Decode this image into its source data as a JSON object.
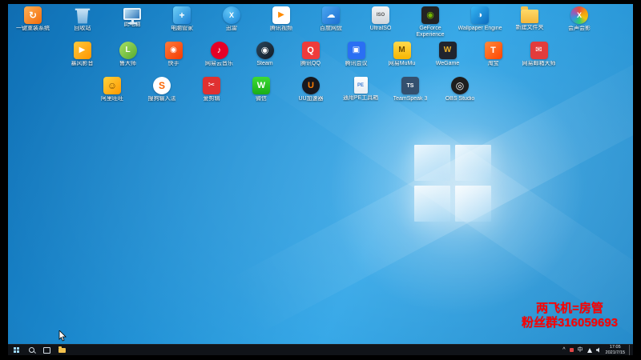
{
  "colors": {
    "wallpaper_base": "#1e8fd4",
    "taskbar": "#101318",
    "overlay_text": "#ff0000",
    "icon_label_text": "#ffffff"
  },
  "overlay": {
    "line1": "两飞机=房管",
    "line2": "粉丝群316059693"
  },
  "taskbar": {
    "tray": {
      "hidden_icons": "^",
      "ime": "中",
      "time": "17:05",
      "date": "2021/7/15"
    }
  },
  "desktop": {
    "rows": [
      {
        "items": [
          {
            "name": "yijian-chongzhuang",
            "label": "一键重装系统",
            "bg": "linear-gradient(135deg,#ffb054,#f26c0d)",
            "glyph": "↻",
            "gs": 12
          },
          {
            "name": "recycle-bin",
            "label": "回收站",
            "shape": "bin"
          },
          {
            "name": "this-pc",
            "label": "此电脑",
            "shape": "monitor"
          },
          {
            "name": "diannao-guanjia",
            "label": "电脑管家",
            "bg": "linear-gradient(135deg,#6fd0f7,#1a7fd4)",
            "glyph": "+",
            "gs": 12
          },
          {
            "name": "xunlei",
            "label": "迅雷",
            "shape": "circle",
            "bg": "radial-gradient(circle at 35% 30%,#5fc3f5,#1582d6)",
            "glyph": "X",
            "gs": 9
          },
          {
            "name": "tengxun-shipin",
            "label": "腾讯视频",
            "bg": "#ffffff",
            "glyph": "▶",
            "fg": "#ff8a00",
            "gs": 10
          },
          {
            "name": "baidu-wangpan",
            "label": "百度网盘",
            "bg": "linear-gradient(135deg,#4aa7f0,#1d6fd2)",
            "glyph": "☁",
            "gs": 11
          },
          {
            "name": "ultraiso",
            "label": "UltraISO",
            "bg": "linear-gradient(#f2f4f6,#cfd6dc)",
            "glyph": "ISO",
            "fg": "#555555",
            "gs": 6
          },
          {
            "name": "geforce-experience",
            "label": "GeForce Experience",
            "bg": "#232323",
            "glyph": "◉",
            "fg": "#76b900",
            "gs": 11
          },
          {
            "name": "wallpaper-engine",
            "label": "Wallpaper Engine",
            "bg": "linear-gradient(135deg,#35b5f2,#0c6cc0)",
            "glyph": "◑",
            "gs": 11
          },
          {
            "name": "new-folder",
            "label": "新建文件夹",
            "shape": "folder"
          },
          {
            "name": "huishenghuiying",
            "label": "会声会影",
            "shape": "circle",
            "bg": "conic-gradient(#e74c3c,#f39c12,#f1c40f,#2ecc71,#3498db,#9b59b6,#e74c3c)",
            "glyph": "X",
            "gs": 9
          }
        ]
      },
      {
        "items": [
          {
            "name": "baofeng-yingyin",
            "label": "暴风影音",
            "bg": "linear-gradient(135deg,#ffc93c,#ff9500)",
            "glyph": "▶",
            "gs": 10
          },
          {
            "name": "ludashi",
            "label": "鲁大师",
            "shape": "circle",
            "bg": "linear-gradient(135deg,#a8e063,#56ab2f)",
            "glyph": "L",
            "gs": 10
          },
          {
            "name": "kuaishou",
            "label": "快手",
            "bg": "linear-gradient(135deg,#ff7a3c,#f43b00)",
            "glyph": "◉",
            "gs": 10
          },
          {
            "name": "netease-music",
            "label": "网易云音乐",
            "shape": "circle",
            "bg": "#e60026",
            "glyph": "♪",
            "gs": 11
          },
          {
            "name": "steam",
            "label": "Steam",
            "shape": "circle",
            "bg": "linear-gradient(135deg,#2a475e,#121a24)",
            "glyph": "◉",
            "gs": 11
          },
          {
            "name": "tengxun-qq",
            "label": "腾讯QQ",
            "bg": "#ef3b3b",
            "glyph": "Q",
            "gs": 11
          },
          {
            "name": "tencent-meeting",
            "label": "腾讯会议",
            "bg": "#2a6ff3",
            "glyph": "▣",
            "gs": 10
          },
          {
            "name": "netease-mumu",
            "label": "网易MuMu",
            "bg": "linear-gradient(#ffd94d,#f7b500)",
            "glyph": "M",
            "fg": "#6b4a00",
            "gs": 10
          },
          {
            "name": "wegame",
            "label": "WeGame",
            "bg": "#20242e",
            "glyph": "W",
            "fg": "#f0b429",
            "gs": 10
          },
          {
            "name": "taobao",
            "label": "淘宝",
            "bg": "linear-gradient(135deg,#ff8a3c,#ff4400)",
            "glyph": "T",
            "gs": 11
          },
          {
            "name": "mail-master",
            "label": "网易邮箱大师",
            "bg": "#e23c3c",
            "glyph": "✉",
            "gs": 10
          }
        ]
      },
      {
        "items": [
          {
            "name": "ali-wangwang",
            "label": "阿里旺旺",
            "bg": "linear-gradient(135deg,#ffd23c,#ff9800)",
            "glyph": "☺",
            "fg": "#7a4a00",
            "gs": 12
          },
          {
            "name": "sogou-pinyin",
            "label": "搜狗输入法",
            "shape": "circle",
            "bg": "#ffffff",
            "glyph": "S",
            "fg": "#fa6400",
            "gs": 12
          },
          {
            "name": "aijianji",
            "label": "爱剪辑",
            "bg": "#e03131",
            "glyph": "✂",
            "gs": 10
          },
          {
            "name": "wechat",
            "label": "微信",
            "bg": "linear-gradient(#3ddb34,#1aad19)",
            "glyph": "W",
            "gs": 11
          },
          {
            "name": "uu-booster",
            "label": "UU加速器",
            "shape": "circle",
            "bg": "#17191f",
            "glyph": "U",
            "fg": "#ff7d00",
            "gs": 11
          },
          {
            "name": "tongyong-pe",
            "label": "通用PE工具箱",
            "shape": "doc",
            "glyph": "PE",
            "fg": "#3a7bd5",
            "gs": 6
          },
          {
            "name": "teamspeak",
            "label": "TeamSpeak 3",
            "bg": "#34506e",
            "glyph": "TS",
            "gs": 7
          },
          {
            "name": "obs-studio",
            "label": "OBS Studio",
            "shape": "circle",
            "bg": "#1e1e1e",
            "glyph": "◎",
            "gs": 12
          }
        ]
      }
    ]
  }
}
